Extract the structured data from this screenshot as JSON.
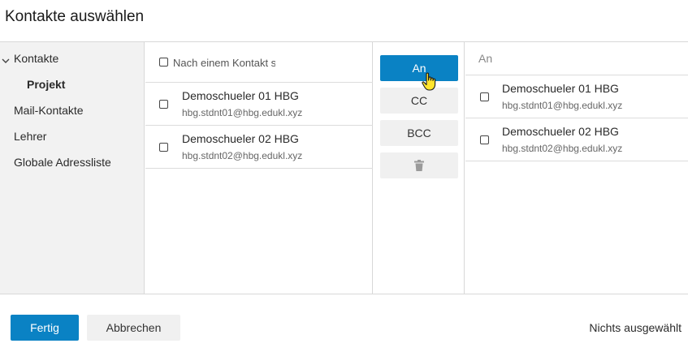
{
  "dialog": {
    "title": "Kontakte auswählen"
  },
  "sidebar": {
    "items": [
      {
        "label": "Kontakte",
        "expanded": true
      },
      {
        "label": "Projekt",
        "active": true
      },
      {
        "label": "Mail-Kontakte"
      },
      {
        "label": "Lehrer"
      },
      {
        "label": "Globale Adressliste"
      }
    ]
  },
  "search": {
    "placeholder": "Nach einem Kontakt suchen",
    "value": ""
  },
  "contacts": [
    {
      "name": "Demoschueler 01 HBG",
      "email": "hbg.stdnt01@hbg.edukl.xyz"
    },
    {
      "name": "Demoschueler 02 HBG",
      "email": "hbg.stdnt02@hbg.edukl.xyz"
    }
  ],
  "actions": {
    "to": "An",
    "cc": "CC",
    "bcc": "BCC",
    "delete_icon": "trash-icon"
  },
  "recipients": {
    "header": "An",
    "items": [
      {
        "name": "Demoschueler 01 HBG",
        "email": "hbg.stdnt01@hbg.edukl.xyz"
      },
      {
        "name": "Demoschueler 02 HBG",
        "email": "hbg.stdnt02@hbg.edukl.xyz"
      }
    ]
  },
  "footer": {
    "done": "Fertig",
    "cancel": "Abbrechen",
    "status": "Nichts ausgewählt"
  },
  "colors": {
    "primary": "#0a82c4",
    "secondary_button": "#f0f0f0",
    "sidebar_bg": "#f2f2f2"
  }
}
